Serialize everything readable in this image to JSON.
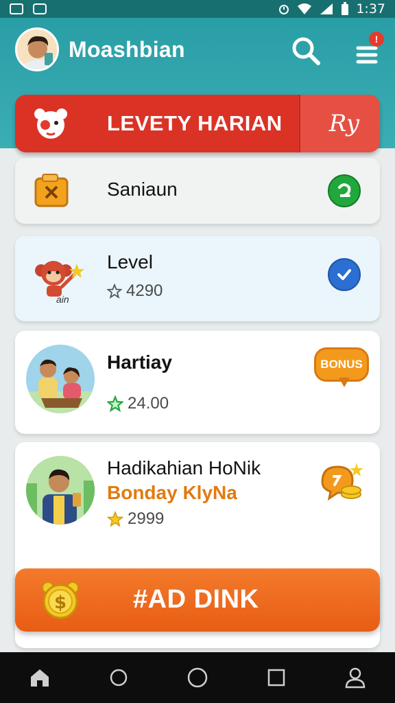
{
  "status_bar": {
    "time": "1:37",
    "icons": [
      "gallery-icon",
      "checkbox-icon",
      "alarm-icon",
      "wifi-icon",
      "signal-icon",
      "battery-icon"
    ]
  },
  "header": {
    "app_title": "Moashbian",
    "notification_count": "!",
    "icons": {
      "search": "search-icon",
      "menu": "menu-icon"
    }
  },
  "banner": {
    "title": "LEVETY HARIAN",
    "action_label": "Ry",
    "mascot_icon": "bear-mascot-icon"
  },
  "cards": [
    {
      "title": "Saniaun",
      "icon": "folder-x-icon",
      "badge_icon": "green-circle-icon"
    },
    {
      "title": "Level",
      "stars": "4290",
      "icon": "monkey-mascot-icon",
      "mascot_caption": "ain",
      "badge_icon": "check-circle-icon"
    },
    {
      "title": "Hartiay",
      "stars": "24.00",
      "badge": "BONUS",
      "image": "family-photo"
    },
    {
      "title": "Hadikahian HoNik",
      "subtitle": "Bonday KlyNa",
      "stars": "2999",
      "image": "man-phone-photo",
      "badge_icon": "coins-chat-icon"
    }
  ],
  "cta": {
    "label": "#AD DINK",
    "icon": "coin-dollar-icon"
  },
  "nav": {
    "items": [
      "home-icon",
      "circle-icon",
      "circle-icon",
      "square-icon",
      "profile-icon"
    ]
  },
  "colors": {
    "header": "#2a9ea6",
    "banner": "#db3226",
    "cta": "#e85d14",
    "check": "#2a6fd1",
    "green": "#20a83c",
    "bonus": "#f39a1d",
    "subtitle": "#e07b10"
  }
}
